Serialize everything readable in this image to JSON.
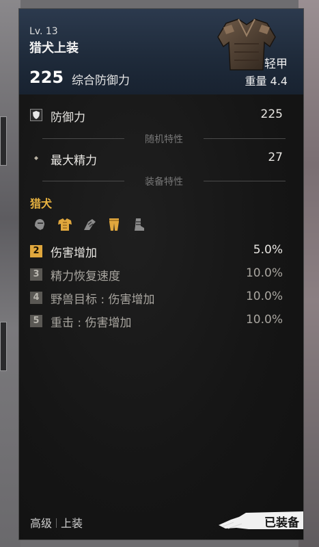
{
  "item": {
    "level": "Lv. 13",
    "name": "猎犬上装",
    "armor_total": "225",
    "armor_total_label": "综合防御力",
    "armor_type": "轻甲",
    "weight": "重量 4.4"
  },
  "stats": [
    {
      "icon": "shield-icon",
      "label": "防御力",
      "value": "225"
    }
  ],
  "random_traits": {
    "header": "随机特性",
    "items": [
      {
        "icon": "diamond-bullet-icon",
        "label": "最大精力",
        "value": "27"
      }
    ]
  },
  "equipment_traits": {
    "header": "装备特性",
    "set_name": "猎犬",
    "set_pieces": [
      {
        "icon": "helmet-icon",
        "owned": false
      },
      {
        "icon": "chest-armor-icon",
        "owned": true
      },
      {
        "icon": "gauntlet-icon",
        "owned": false
      },
      {
        "icon": "leggings-icon",
        "owned": true
      },
      {
        "icon": "boots-icon",
        "owned": false
      }
    ],
    "bonuses": [
      {
        "count": "2",
        "label": "伤害增加",
        "value": "5.0%",
        "active": true
      },
      {
        "count": "3",
        "label": "精力恢复速度",
        "value": "10.0%",
        "active": false
      },
      {
        "count": "4",
        "label": "野兽目标 : 伤害增加",
        "value": "10.0%",
        "active": false
      },
      {
        "count": "5",
        "label": "重击 : 伤害增加",
        "value": "10.0%",
        "active": false
      }
    ]
  },
  "footer": {
    "rarity": "高级",
    "slot": "上装",
    "equipped_label": "已装备"
  },
  "colors": {
    "accent_gold": "#e0a73d",
    "header_blue": "#1f2b3b",
    "panel_bg": "#141414"
  }
}
